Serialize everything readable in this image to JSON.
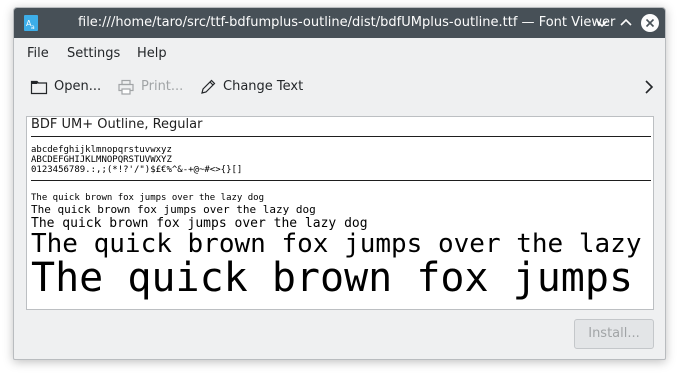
{
  "window": {
    "title": "file:///home/taro/src/ttf-bdfumplus-outline/dist/bdfUMplus-outline.ttf — Font Viewer"
  },
  "menu": {
    "file": "File",
    "settings": "Settings",
    "help": "Help"
  },
  "toolbar": {
    "open_label": "Open...",
    "print_label": "Print...",
    "change_text_label": "Change Text"
  },
  "preview": {
    "font_name": "BDF UM+ Outline, Regular",
    "charset_lines": [
      "abcdefghijklmnopqrstuvwxyz",
      "ABCDEFGHIJKLMNOPQRSTUVWXYZ",
      "0123456789.:,;(*!?'/\")$£€%^&-+@~#<>{}[]"
    ],
    "sample_text": "The quick brown fox jumps over the lazy dog"
  },
  "install_button": {
    "label": "Install..."
  },
  "colors": {
    "titlebar": "#475057",
    "window_bg": "#eff0f1",
    "disabled_text": "#a1a4a6",
    "accent": "#3daee9"
  },
  "icons": {
    "app": "font-viewer-app-icon",
    "open": "folder-open-icon",
    "print": "printer-icon",
    "change_text": "pencil-icon",
    "overflow": "chevron-right-icon"
  }
}
